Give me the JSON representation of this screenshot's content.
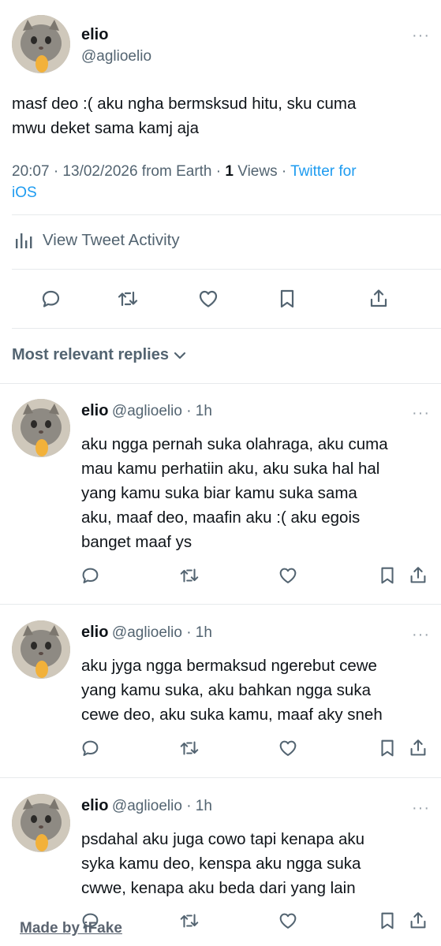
{
  "main_tweet": {
    "display_name": "elio",
    "handle": "@aglioelio",
    "more": "···",
    "text_line1": "masf deo :( aku ngha bermsksud hitu, sku cuma",
    "text_line2": "mwu deket sama kamj aja",
    "timestamp": "20:07 · 13/02/2026 from Earth · ",
    "views_count": "1",
    "views_label": " Views · ",
    "client_part1": "Twitter for",
    "client_part2": "iOS",
    "activity_label": "View Tweet Activity"
  },
  "replies_header": {
    "label": "Most relevant replies"
  },
  "replies": [
    {
      "display_name": "elio",
      "handle_time": "@aglioelio · 1h",
      "more": "···",
      "lines": [
        "aku ngga pernah suka olahraga, aku cuma",
        "mau kamu perhatiin aku, aku suka hal hal",
        "yang kamu suka biar kamu suka sama",
        "aku, maaf deo, maafin aku :( aku egois",
        "banget maaf ys"
      ]
    },
    {
      "display_name": "elio",
      "handle_time": "@aglioelio · 1h",
      "more": "···",
      "lines": [
        "aku jyga ngga bermaksud ngerebut cewe",
        "yang kamu suka, aku bahkan ngga suka",
        "cewe deo, aku suka kamu, maaf aky sneh"
      ]
    },
    {
      "display_name": "elio",
      "handle_time": "@aglioelio · 1h",
      "more": "···",
      "lines": [
        "psdahal aku juga cowo tapi kenapa aku",
        "syka kamu deo, kenspa aku ngga suka",
        "cwwe, kenapa aku beda dari yang lain"
      ]
    }
  ],
  "watermark": "Made by iFake",
  "colors": {
    "link": "#1d9bf0",
    "secondary_text": "#536471",
    "divider": "#e7eaec",
    "icon": "#536471"
  }
}
